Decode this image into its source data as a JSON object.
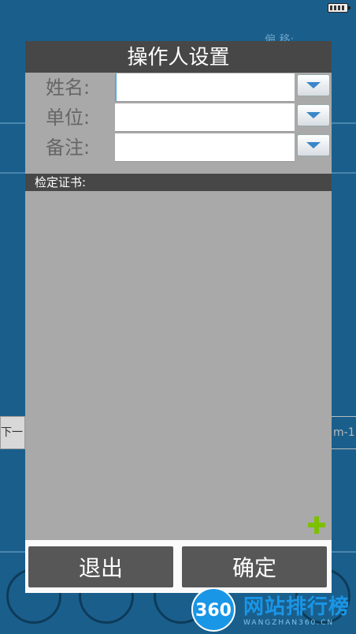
{
  "background": {
    "offset_label": "偏 移:",
    "left_button": "下一",
    "right_field": "m-1"
  },
  "dialog": {
    "title": "操作人设置",
    "fields": [
      {
        "label": "姓名:",
        "value": "",
        "placeholder": ""
      },
      {
        "label": "单位:",
        "value": "",
        "placeholder": ""
      },
      {
        "label": "备注:",
        "value": "",
        "placeholder": ""
      }
    ],
    "cert_header": "检定证书:",
    "exit_label": "退出",
    "ok_label": "确定"
  },
  "watermark": {
    "logo": "360",
    "text": "网站排行榜",
    "sub": "WANGZHAN360.CN"
  },
  "colors": {
    "background": "#1a5f8c",
    "dialog": "#a9a9a9",
    "header": "#474747",
    "button": "#575757",
    "add_icon": "#7cc000"
  },
  "icons": [
    "battery-icon",
    "chevron-down-icon",
    "plus-icon"
  ]
}
